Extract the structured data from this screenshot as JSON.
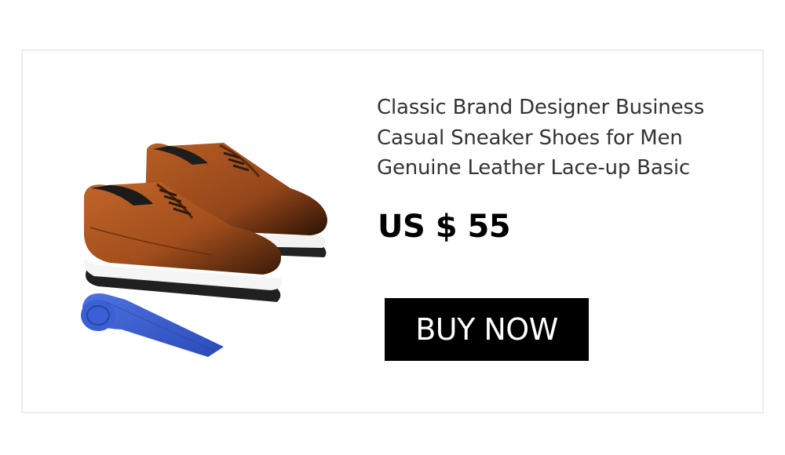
{
  "product": {
    "title": "Classic Brand Designer Business Casual Sneaker Shoes for Men Genuine Leather Lace-up Basic",
    "price": "US $ 55",
    "image_icon": "product-photo-shoes-and-tie"
  },
  "actions": {
    "buy_label": "BUY NOW"
  },
  "colors": {
    "button_bg": "#000000",
    "button_text": "#ffffff",
    "leather": "#a24e1c",
    "tie": "#3a5ed1"
  }
}
